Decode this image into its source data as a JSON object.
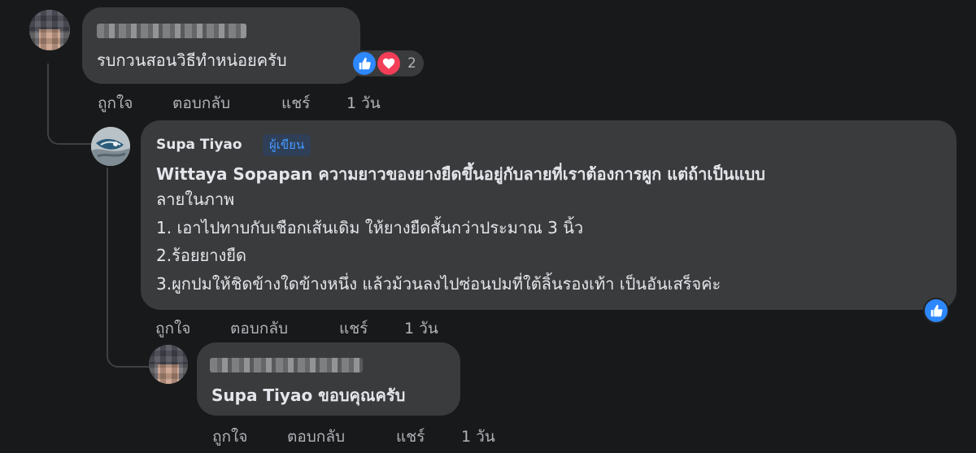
{
  "comments": [
    {
      "author": "",
      "text": "รบกวนสอนวิธีทำหน่อยครับ",
      "reaction_count": "2",
      "actions": {
        "like": "ถูกใจ",
        "reply": "ตอบกลับ",
        "share": "แชร์",
        "time": "1 วัน"
      }
    },
    {
      "author": "Supa Tiyao",
      "badge": "ผู้เขียน",
      "lines": [
        "Wittaya Sopapan ความยาวของยางยืดขึ้นอยู่กับลายที่เราต้องการผูก แต่ถ้าเป็นแบบ",
        "ลายในภาพ",
        "1. เอาไปทาบกับเชือกเส้นเดิม ให้ยางยืดสั้นกว่าประมาณ 3 นิ้ว",
        "2.ร้อยยางยืด",
        "3.ผูกปมให้ชิดข้างใดข้างหนึ่ง แล้วม้วนลงไปซ่อนปมที่ใต้ลิ้นรองเท้า เป็นอันเสร็จค่ะ"
      ],
      "actions": {
        "like": "ถูกใจ",
        "reply": "ตอบกลับ",
        "share": "แชร์",
        "time": "1 วัน"
      }
    },
    {
      "author": "",
      "text": "Supa Tiyao ขอบคุณครับ",
      "actions": {
        "like": "ถูกใจ",
        "reply": "ตอบกลับ",
        "share": "แชร์",
        "time": "1 วัน"
      }
    }
  ],
  "colors": {
    "background": "#18191a",
    "bubble": "#3a3b3c",
    "like_blue": "#2d88ff",
    "love_red": "#f33e58",
    "badge_text": "#4599ff"
  },
  "icons": [
    "like-icon",
    "love-icon"
  ]
}
